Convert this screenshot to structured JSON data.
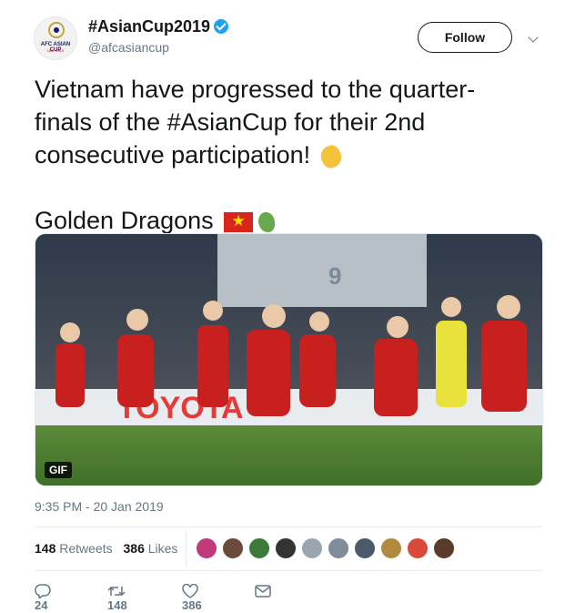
{
  "author": {
    "name": "#AsianCup2019",
    "handle": "@afcasiancup",
    "avatar_logo": "AFC ASIAN CUP",
    "avatar_sub": "UAE 2019",
    "verified": true
  },
  "follow_label": "Follow",
  "tweet": {
    "line1": "Vietnam have progressed to the quarter-",
    "line2": "finals of the #AsianCup for their 2nd",
    "line3": "consecutive participation!",
    "line4": "Golden Dragons"
  },
  "media": {
    "badge": "GIF",
    "banner_text": "TOYOTA",
    "stand_number": "9"
  },
  "timestamp": "9:35 PM - 20 Jan 2019",
  "stats": {
    "retweets_count": "148",
    "retweets_label": "Retweets",
    "likes_count": "386",
    "likes_label": "Likes"
  },
  "likers_colors": [
    "#c0397b",
    "#6b4c3b",
    "#3d7a3a",
    "#333333",
    "#9aa5ad",
    "#7f8c99",
    "#4a5a6a",
    "#b08a3e",
    "#d84a3a",
    "#5a3a2a"
  ],
  "actions": {
    "reply_count": "24",
    "retweet_count": "148",
    "like_count": "386"
  },
  "colors": {
    "brand_blue": "#1da1f2",
    "text": "#14171a",
    "secondary": "#657786"
  }
}
